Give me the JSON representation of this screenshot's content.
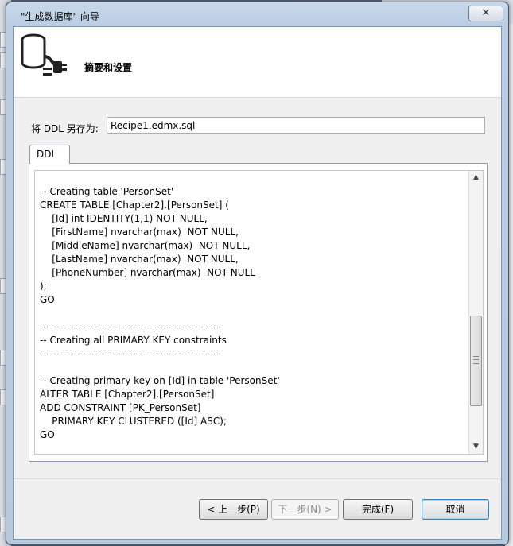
{
  "window": {
    "title": "\"生成数据库\" 向导",
    "close_glyph": "✕"
  },
  "header": {
    "title": "摘要和设置",
    "icon": "database-plug-icon"
  },
  "save_as": {
    "label": "将 DDL 另存为:",
    "value": "Recipe1.edmx.sql"
  },
  "tabs": [
    {
      "label": "DDL",
      "selected": true
    }
  ],
  "ddl_lines": [
    "-- Creating table 'PersonSet'",
    "CREATE TABLE [Chapter2].[PersonSet] (",
    "    [Id] int IDENTITY(1,1) NOT NULL,",
    "    [FirstName] nvarchar(max)  NOT NULL,",
    "    [MiddleName] nvarchar(max)  NOT NULL,",
    "    [LastName] nvarchar(max)  NOT NULL,",
    "    [PhoneNumber] nvarchar(max)  NOT NULL",
    ");",
    "GO",
    "",
    "-- --------------------------------------------------",
    "-- Creating all PRIMARY KEY constraints",
    "-- --------------------------------------------------",
    "",
    "-- Creating primary key on [Id] in table 'PersonSet'",
    "ALTER TABLE [Chapter2].[PersonSet]",
    "ADD CONSTRAINT [PK_PersonSet]",
    "    PRIMARY KEY CLUSTERED ([Id] ASC);",
    "GO"
  ],
  "scrollbar": {
    "up": "▲",
    "down": "▼"
  },
  "buttons": {
    "prev": "< 上一步(P)",
    "next": "下一步(N) >",
    "finish": "完成(F)",
    "cancel": "取消"
  }
}
